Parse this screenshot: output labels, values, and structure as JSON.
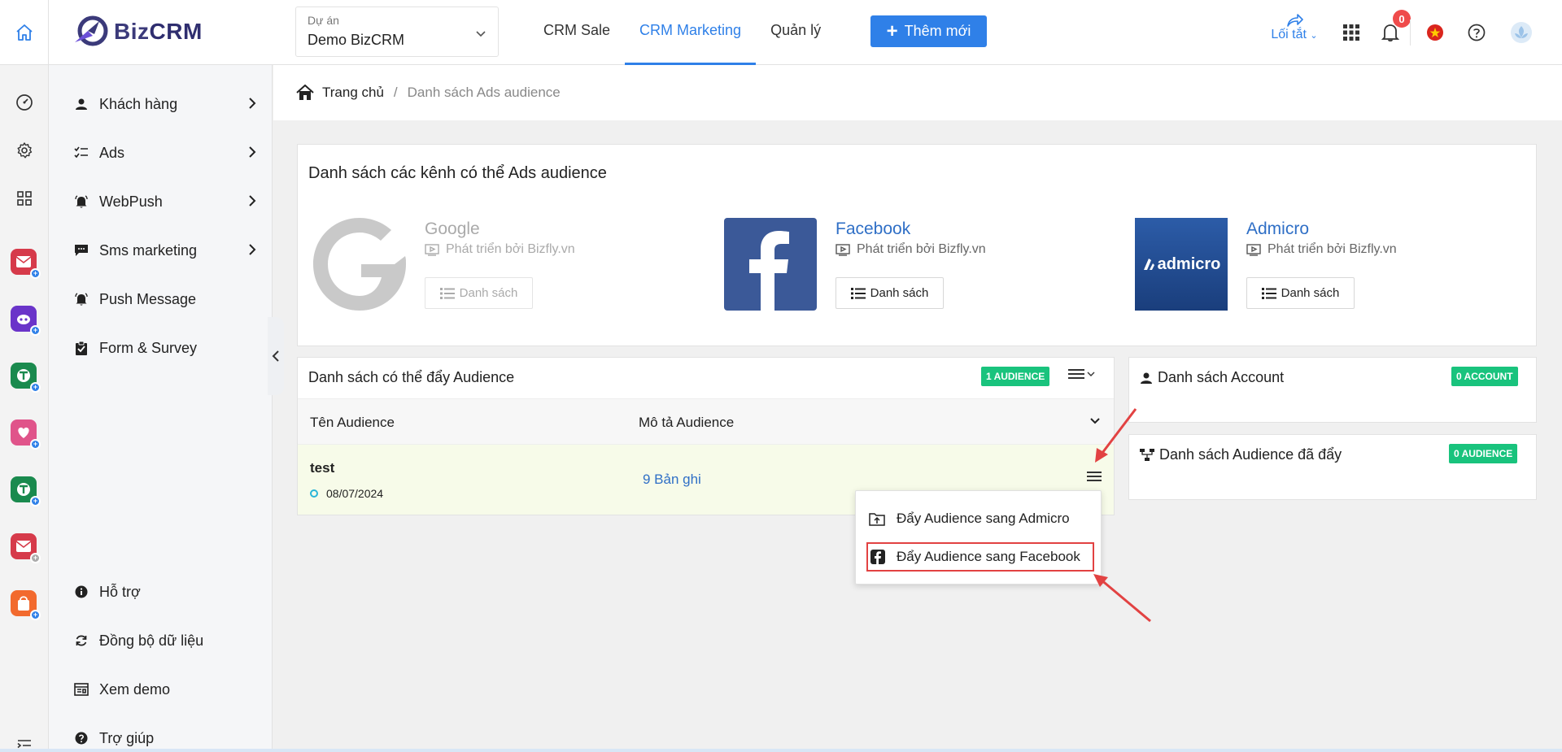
{
  "header": {
    "logo_text": "Biz",
    "logo_text_bold": "CRM",
    "project_label": "Dự án",
    "project_value": "Demo BizCRM",
    "nav": [
      "CRM Sale",
      "CRM Marketing",
      "Quản lý"
    ],
    "add_button": "Thêm mới",
    "shortcut_label": "Lối tắt",
    "notification_count": "0"
  },
  "colors": {
    "accent": "#2f80e8",
    "badge": "#19c37d",
    "highlight": "#e24242"
  },
  "menu": {
    "items": [
      "Khách hàng",
      "Ads",
      "WebPush",
      "Sms marketing",
      "Push Message",
      "Form & Survey"
    ],
    "bottom_items": [
      "Hỗ trợ",
      "Đồng bộ dữ liệu",
      "Xem demo",
      "Trợ giúp"
    ]
  },
  "breadcrumb": {
    "home": "Trang chủ",
    "separator": "/",
    "current": "Danh sách Ads audience"
  },
  "channels": {
    "title": "Danh sách các kênh có thể Ads audience",
    "items": [
      {
        "name": "Google",
        "dev": "Phát triển bởi Bizfly.vn",
        "button": "Danh sách"
      },
      {
        "name": "Facebook",
        "dev": "Phát triển bởi Bizfly.vn",
        "button": "Danh sách"
      },
      {
        "name": "Admicro",
        "dev": "Phát triển bởi Bizfly.vn",
        "button": "Danh sách"
      }
    ],
    "admicro_logo_text": "admicro"
  },
  "audience": {
    "title": "Danh sách có thể đẩy Audience",
    "badge": "1 AUDIENCE",
    "col_name": "Tên Audience",
    "col_desc": "Mô tả Audience",
    "row": {
      "name": "test",
      "date": "08/07/2024",
      "desc": "9 Bản ghi"
    }
  },
  "account": {
    "title": "Danh sách Account",
    "badge": "0 ACCOUNT"
  },
  "pushed": {
    "title": "Danh sách Audience đã đẩy",
    "badge": "0 AUDIENCE"
  },
  "dropdown": {
    "items": [
      "Đẩy Audience sang Admicro",
      "Đẩy Audience sang Facebook"
    ]
  }
}
